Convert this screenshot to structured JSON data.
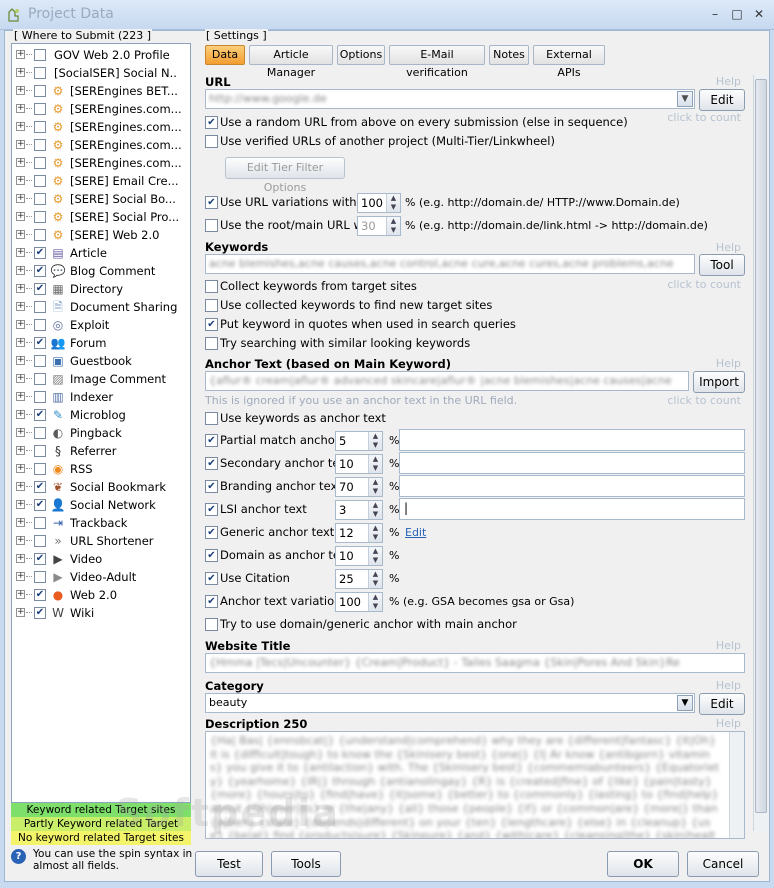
{
  "window": {
    "title": "Project Data",
    "min": "–",
    "max": "□",
    "close": "✕"
  },
  "left": {
    "group_label": "[ Where to Submit  (223 ]",
    "items": [
      {
        "label": "GOV Web 2.0 Profile",
        "checked": false,
        "icon": ""
      },
      {
        "label": "[SocialSER] Social N...",
        "checked": false,
        "icon": ""
      },
      {
        "label": "[SEREngines BET...",
        "checked": false,
        "icon": "gear"
      },
      {
        "label": "[SEREngines.com...",
        "checked": false,
        "icon": "gear"
      },
      {
        "label": "[SEREngines.com...",
        "checked": false,
        "icon": "gear"
      },
      {
        "label": "[SEREngines.com...",
        "checked": false,
        "icon": "gear"
      },
      {
        "label": "[SEREngines.com...",
        "checked": false,
        "icon": "gear"
      },
      {
        "label": "[SERE] Email Cre...",
        "checked": false,
        "icon": "gear"
      },
      {
        "label": "[SERE] Social Bo...",
        "checked": false,
        "icon": "gear"
      },
      {
        "label": "[SERE] Social Pro...",
        "checked": false,
        "icon": "gear"
      },
      {
        "label": "[SERE] Web 2.0",
        "checked": false,
        "icon": "gear"
      },
      {
        "label": "Article",
        "checked": true,
        "icon": "article"
      },
      {
        "label": "Blog Comment",
        "checked": true,
        "icon": "comment"
      },
      {
        "label": "Directory",
        "checked": true,
        "icon": "directory"
      },
      {
        "label": "Document Sharing",
        "checked": false,
        "icon": "document"
      },
      {
        "label": "Exploit",
        "checked": false,
        "icon": "exploit"
      },
      {
        "label": "Forum",
        "checked": true,
        "icon": "forum"
      },
      {
        "label": "Guestbook",
        "checked": false,
        "icon": "guestbook"
      },
      {
        "label": "Image Comment",
        "checked": false,
        "icon": "image"
      },
      {
        "label": "Indexer",
        "checked": false,
        "icon": "indexer"
      },
      {
        "label": "Microblog",
        "checked": true,
        "icon": "microblog"
      },
      {
        "label": "Pingback",
        "checked": false,
        "icon": "pingback"
      },
      {
        "label": "Referrer",
        "checked": false,
        "icon": "referrer"
      },
      {
        "label": "RSS",
        "checked": false,
        "icon": "rss"
      },
      {
        "label": "Social Bookmark",
        "checked": true,
        "icon": "bookmark"
      },
      {
        "label": "Social Network",
        "checked": true,
        "icon": "network"
      },
      {
        "label": "Trackback",
        "checked": false,
        "icon": "trackback"
      },
      {
        "label": "URL Shortener",
        "checked": false,
        "icon": "shortener"
      },
      {
        "label": "Video",
        "checked": true,
        "icon": "video"
      },
      {
        "label": "Video-Adult",
        "checked": false,
        "icon": "video-adult"
      },
      {
        "label": "Web 2.0",
        "checked": true,
        "icon": "web20"
      },
      {
        "label": "Wiki",
        "checked": true,
        "icon": "wiki"
      }
    ],
    "legend": [
      {
        "label": "Keyword related Target sites",
        "color": "#7ee06a"
      },
      {
        "label": "Partly Keyword related Target sites",
        "color": "#c9ee6a"
      },
      {
        "label": "No keyword related Target sites",
        "color": "#f4f46a"
      }
    ],
    "hint": "You can use the spin syntax in almost all fields."
  },
  "settings": {
    "group_label": "[ Settings ]",
    "tabs": [
      "Data",
      "Article Manager",
      "Options",
      "E-Mail verification",
      "Notes",
      "External APIs"
    ],
    "active_tab": "Data",
    "help": "Help",
    "click_to_count": "click to count",
    "url": {
      "title": "URL",
      "value": "http://www.google.de",
      "edit": "Edit",
      "random_label": "Use a random URL from above on every submission (else in sequence)",
      "random_checked": true,
      "verified_label": "Use verified URLs of another project (Multi-Tier/Linkwheel)",
      "verified_checked": false,
      "tier_filter": "Edit Tier Filter Options",
      "variations_label": "Use URL variations with",
      "variations_checked": true,
      "variations_value": "100",
      "variations_note": "% (e.g. http://domain.de/ HTTP://www.Domain.de)",
      "root_label": "Use the root/main URL with",
      "root_checked": false,
      "root_value": "30",
      "root_note": "% (e.g. http://domain.de/link.html -> http://domain.de)"
    },
    "keywords": {
      "title": "Keywords",
      "value": "acne blemishes,acne causes,acne control,acne cure,acne cures,acne problems,acne",
      "tool": "Tool",
      "options": [
        {
          "label": "Collect keywords from target sites",
          "checked": false
        },
        {
          "label": "Use collected keywords to find new target sites",
          "checked": false
        },
        {
          "label": "Put keyword in quotes when used in search queries",
          "checked": true
        },
        {
          "label": "Try searching with similar looking keywords",
          "checked": false
        }
      ]
    },
    "anchor": {
      "title": "Anchor Text (based on Main Keyword)",
      "value": "{aflur® cream|aflur® advanced skincare|aflur® |acne blemishes|acne causes|acne",
      "import": "Import",
      "ignored_note": "This is ignored if you use an anchor text in the URL field.",
      "use_keywords_label": "Use keywords as anchor text",
      "use_keywords_checked": false,
      "rows": [
        {
          "label": "Partial match anchor text",
          "checked": true,
          "value": "5",
          "suffix": "%",
          "text": ""
        },
        {
          "label": "Secondary anchor text",
          "checked": true,
          "value": "10",
          "suffix": "%",
          "text": ""
        },
        {
          "label": "Branding anchor text",
          "checked": true,
          "value": "70",
          "suffix": "%",
          "text": ""
        },
        {
          "label": "LSI anchor text",
          "checked": true,
          "value": "3",
          "suffix": "%",
          "text": "|"
        },
        {
          "label": "Generic anchor text",
          "checked": true,
          "value": "12",
          "suffix": "%",
          "link": "Edit"
        },
        {
          "label": "Domain as anchor text",
          "checked": true,
          "value": "10",
          "suffix": "%"
        },
        {
          "label": "Use Citation",
          "checked": true,
          "value": "25",
          "suffix": "%"
        },
        {
          "label": "Anchor text variations",
          "checked": true,
          "value": "100",
          "suffix": "% (e.g. GSA becomes gsa or Gsa)"
        }
      ],
      "domain_generic_label": "Try to use domain/generic anchor with main anchor",
      "domain_generic_checked": false
    },
    "website_title": {
      "title": "Website Title",
      "value": "{Hmma |Tecs|Uncounter} {Cream|Product} - Tailes Saagma {Skin|Pores And Skin}Re"
    },
    "category": {
      "title": "Category",
      "value": "beauty",
      "edit": "Edit"
    },
    "description": {
      "title": "Description 250",
      "text": "{Ha| Bas| {ennsbcat|} {understand|comprehend} why they are {different|fantasc} {It|Oh} it is {difficult|tough} to know the {Skinisery best} {one|} {I| Ar know {antibgorn} vitamins} you give it to {antilaction} with. The {Skinisery best} {commemiabunteers} {Equatoriety} {yearhome} {IR|} through {antianolingay} {R} is {created|fine} of {like} {pain|tasty} {more} {hours|to} {find|have} {it|some} {better} to {commonly} {lasting} to {find|help} about {Oh|ever|its} or {the|any} {all} those {people} {if} or {common|are} {more|} than {a|ben} {state} {depends|different} on your {ten} {lengthcare} {else} in {cleanup} {use} {be|at} find {products|sure} {Skinpure} {and} {with|care} {cleansing|the} {skin|health}"
    }
  },
  "footer": {
    "test": "Test",
    "tools": "Tools",
    "ok": "OK",
    "cancel": "Cancel"
  },
  "watermark": "Softpedia"
}
